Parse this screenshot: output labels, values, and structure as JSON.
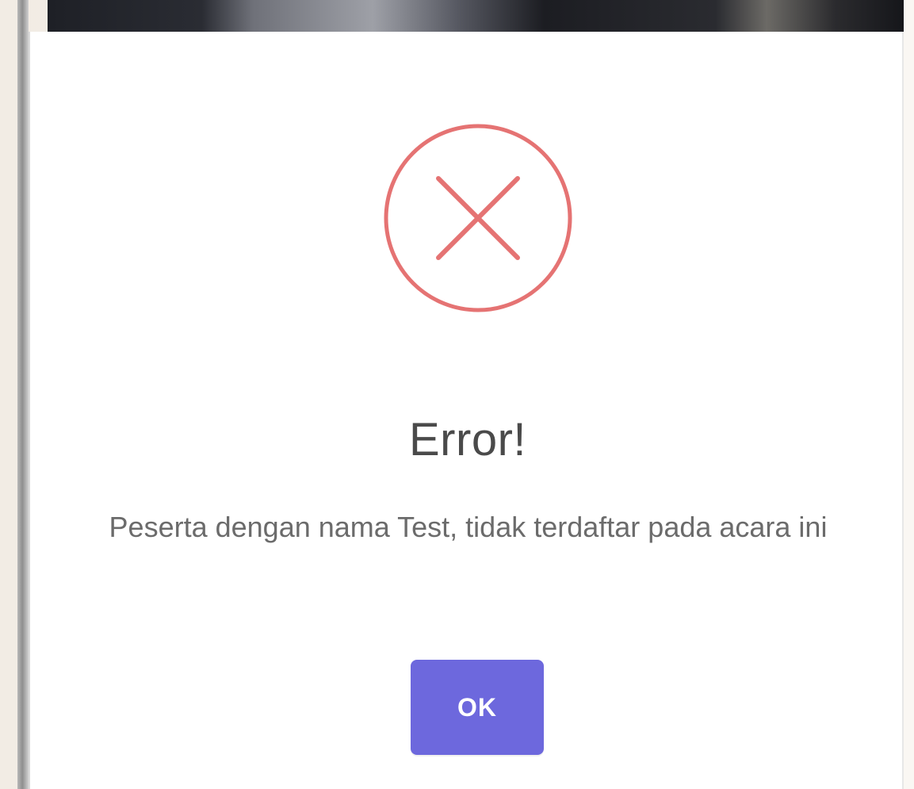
{
  "dialog": {
    "title": "Error!",
    "message": "Peserta dengan nama Test, tidak terdaftar pada acara ini",
    "ok_label": "OK",
    "icon": "error-circle-icon"
  },
  "colors": {
    "accent": "#6d68dd",
    "error": "#e57373",
    "title_text": "#4a4a4a",
    "message_text": "#6b6b6b"
  }
}
